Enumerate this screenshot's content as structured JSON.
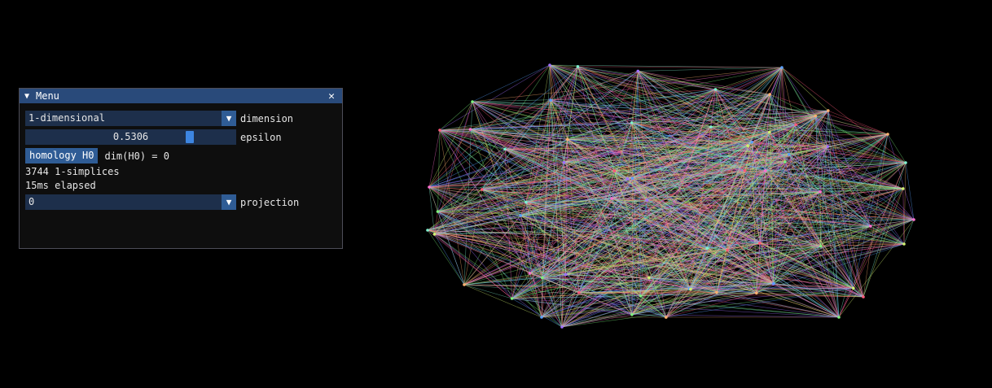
{
  "menu": {
    "title": "Menu",
    "collapse_icon": "▼",
    "close_icon": "✕",
    "dimension": {
      "value": "1-dimensional",
      "label": "dimension"
    },
    "epsilon": {
      "value": "0.5306",
      "fraction": 0.79,
      "label": "epsilon"
    },
    "homology_button": "homology H0",
    "homology_result": "dim(H0) = 0",
    "simplices": "3744 1-simplices",
    "elapsed": "15ms elapsed",
    "projection": {
      "value": "0",
      "label": "projection"
    }
  },
  "colors": {
    "background": "#000000",
    "titlebar": "#294a7a",
    "frame": "#1d2f4b",
    "button": "#2f5c95",
    "slider_grab": "#3d85e0",
    "edge_palette": [
      "#ff5a7a",
      "#7cf07c",
      "#a070ff",
      "#5aa0ff",
      "#ffb070",
      "#80f0d0",
      "#ff70d0",
      "#d0f070"
    ]
  }
}
